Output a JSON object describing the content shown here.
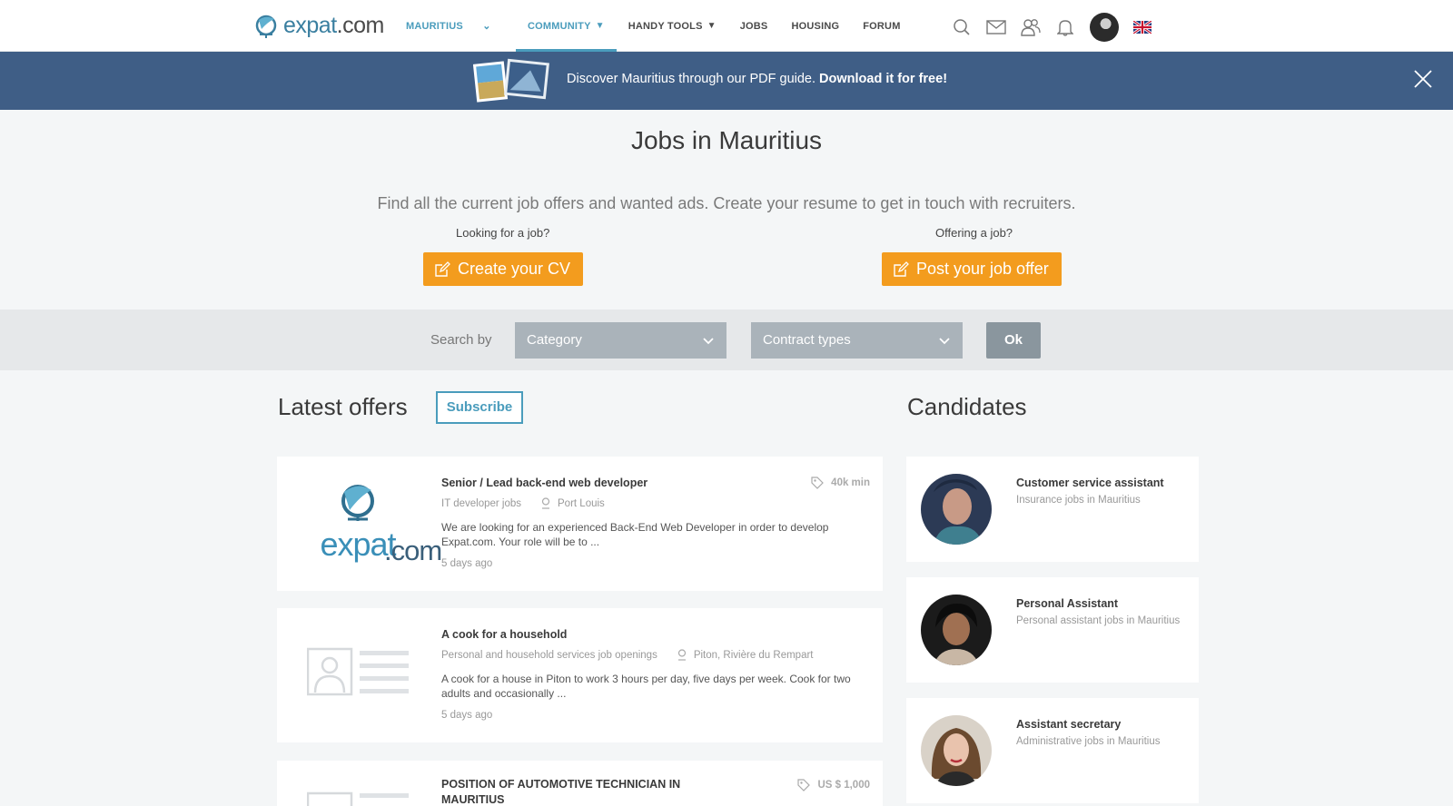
{
  "header": {
    "logo_text": "expat",
    "logo_suffix": ".com",
    "country": "MAURITIUS",
    "nav": [
      {
        "label": "COMMUNITY",
        "has_dropdown": true,
        "active": true
      },
      {
        "label": "HANDY TOOLS",
        "has_dropdown": true,
        "active": false
      },
      {
        "label": "JOBS",
        "has_dropdown": false,
        "active": false
      },
      {
        "label": "HOUSING",
        "has_dropdown": false,
        "active": false
      },
      {
        "label": "FORUM",
        "has_dropdown": false,
        "active": false
      }
    ],
    "icons": [
      "search-icon",
      "mail-icon",
      "friends-icon",
      "bell-icon",
      "user-avatar",
      "uk-flag-icon"
    ],
    "accent_color": "#4a9cbc"
  },
  "banner": {
    "text": "Discover Mauritius through our PDF guide.",
    "cta": "Download it for free!",
    "bg_color": "#3f5e86"
  },
  "hero": {
    "title": "Jobs in Mauritius",
    "subtitle": "Find all the current job offers and wanted ads. Create your resume to get in touch with recruiters.",
    "left_label": "Looking for a job?",
    "left_button": "Create your CV",
    "right_label": "Offering a job?",
    "right_button": "Post your job offer",
    "button_color": "#f39c1e"
  },
  "search": {
    "label": "Search by",
    "category": "Category",
    "contract": "Contract types",
    "ok": "Ok"
  },
  "offers": {
    "title": "Latest offers",
    "subscribe": "Subscribe",
    "items": [
      {
        "title": "Senior / Lead back-end web developer",
        "category": "IT developer jobs",
        "location": "Port Louis",
        "salary": "40k min",
        "description": "We are looking for an experienced Back-End Web Developer in order to develop Expat.com. Your role will be to ...",
        "date": "5 days ago",
        "logo": "expat-logo"
      },
      {
        "title": "A cook for a household",
        "category": "Personal and household services job openings",
        "location": "Piton, Rivière du Rempart",
        "salary": "",
        "description": "A cook for a house in Piton to work 3 hours per day, five days per week. Cook for two adults and occasionally ...",
        "date": "5 days ago",
        "logo": "placeholder-profile"
      },
      {
        "title": "POSITION OF AUTOMOTIVE TECHNICIAN IN MAURITIUS",
        "salary": "US $ 1,000",
        "logo": "placeholder-profile"
      }
    ]
  },
  "candidates": {
    "title": "Candidates",
    "items": [
      {
        "title": "Customer service assistant",
        "subtitle": "Insurance jobs in Mauritius"
      },
      {
        "title": "Personal Assistant",
        "subtitle": "Personal assistant jobs in Mauritius"
      },
      {
        "title": "Assistant secretary",
        "subtitle": "Administrative jobs in Mauritius"
      }
    ]
  }
}
